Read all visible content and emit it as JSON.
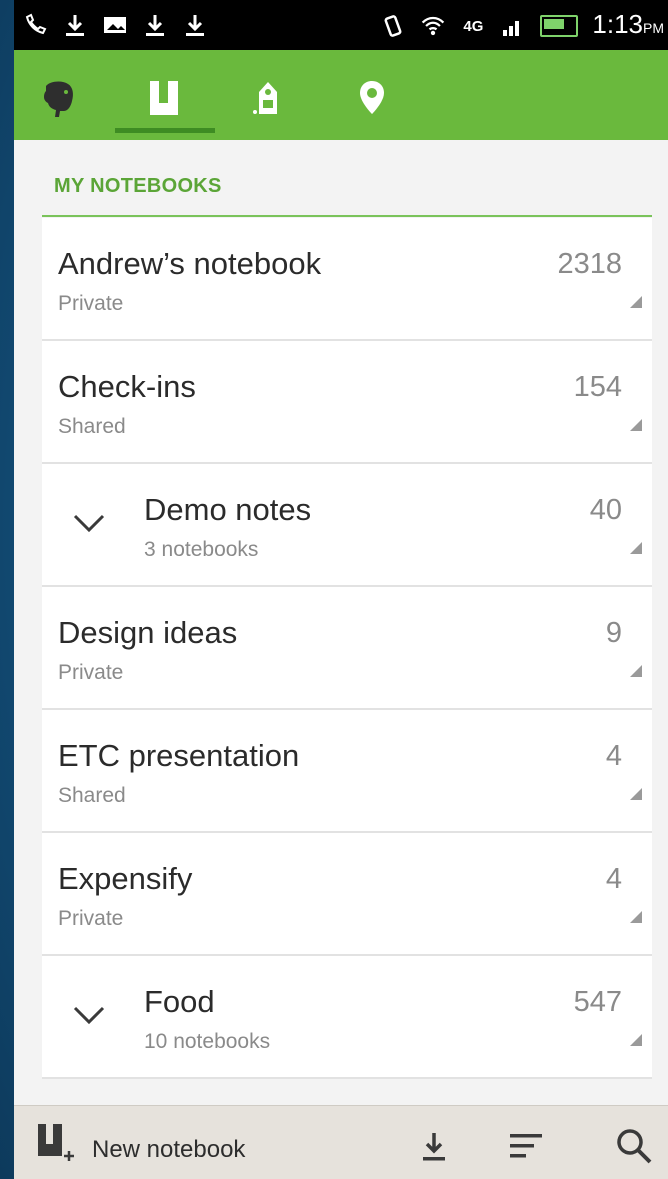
{
  "status_bar": {
    "time": "1:13",
    "time_suffix": "PM",
    "network": "4G"
  },
  "app_bar": {
    "tabs": [
      {
        "icon": "elephant-logo-icon"
      },
      {
        "icon": "notebook-icon",
        "selected": true
      },
      {
        "icon": "tag-icon"
      },
      {
        "icon": "location-pin-icon"
      }
    ],
    "accent": "#6ab93d"
  },
  "section": {
    "title": "MY NOTEBOOKS"
  },
  "notebooks": [
    {
      "name": "Andrew’s notebook",
      "sub": "Private",
      "count": "2318",
      "stack": false
    },
    {
      "name": "Check-ins",
      "sub": "Shared",
      "count": "154",
      "stack": false
    },
    {
      "name": "Demo notes",
      "sub": "3 notebooks",
      "count": "40",
      "stack": true
    },
    {
      "name": "Design ideas",
      "sub": "Private",
      "count": "9",
      "stack": false
    },
    {
      "name": "ETC presentation",
      "sub": "Shared",
      "count": "4",
      "stack": false
    },
    {
      "name": "Expensify",
      "sub": "Private",
      "count": "4",
      "stack": false
    },
    {
      "name": "Food",
      "sub": "10 notebooks",
      "count": "547",
      "stack": true
    }
  ],
  "bottom_bar": {
    "new_notebook_label": "New notebook",
    "icons": [
      "sync-download-icon",
      "sort-icon",
      "search-icon"
    ]
  }
}
